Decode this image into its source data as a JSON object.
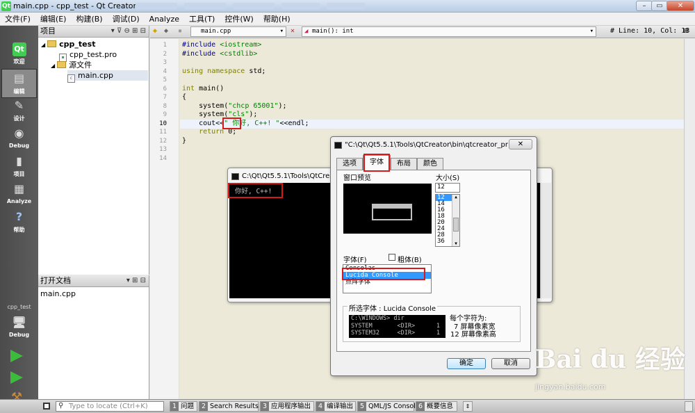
{
  "window": {
    "title": "main.cpp - cpp_test - Qt Creator",
    "qt_logo": "Qt"
  },
  "menu": [
    "文件(F)",
    "编辑(E)",
    "构建(B)",
    "调试(D)",
    "Analyze",
    "工具(T)",
    "控件(W)",
    "帮助(H)"
  ],
  "modes": [
    {
      "label": "欢迎",
      "icon": "qt-logo-icon"
    },
    {
      "label": "编辑",
      "icon": "edit-document-icon"
    },
    {
      "label": "设计",
      "icon": "design-pencil-icon"
    },
    {
      "label": "Debug",
      "icon": "debug-icon"
    },
    {
      "label": "项目",
      "icon": "projects-icon"
    },
    {
      "label": "Analyze",
      "icon": "analyze-icon"
    },
    {
      "label": "帮助",
      "icon": "help-icon"
    }
  ],
  "kit": {
    "project": "cpp_test",
    "config": "Debug"
  },
  "project_panel": {
    "header": "项目",
    "tree": [
      {
        "label": "cpp_test",
        "level": 0
      },
      {
        "label": "cpp_test.pro",
        "level": 1
      },
      {
        "label": "源文件",
        "level": 1
      },
      {
        "label": "main.cpp",
        "level": 2
      }
    ]
  },
  "open_docs": {
    "header": "打开文档",
    "items": [
      "main.cpp"
    ]
  },
  "editor_toolbar": {
    "file": "main.cpp",
    "symbol": "main(): int",
    "position": "Line: 10, Col: 13",
    "hash": "#"
  },
  "code": {
    "line_numbers": [
      "1",
      "2",
      "3",
      "4",
      "5",
      "6",
      "7",
      "8",
      "9",
      "10",
      "11",
      "12",
      "13",
      "14"
    ],
    "current_line": "10",
    "lines": [
      [
        [
          "pp",
          "#include "
        ],
        [
          "str",
          "<iostream>"
        ]
      ],
      [
        [
          "pp",
          "#include "
        ],
        [
          "str",
          "<cstdlib>"
        ]
      ],
      [],
      [
        [
          "kw",
          "using namespace "
        ],
        [
          "",
          "std;"
        ]
      ],
      [],
      [
        [
          "kw",
          "int "
        ],
        [
          "",
          "main()"
        ]
      ],
      [
        [
          "",
          "{"
        ]
      ],
      [
        [
          "",
          "    system("
        ],
        [
          "str",
          "\"chcp 65001\""
        ],
        [
          "",
          ");"
        ]
      ],
      [
        [
          "",
          "    system("
        ],
        [
          "str",
          "\"cls\""
        ],
        [
          "",
          ");"
        ]
      ],
      [
        [
          "",
          "    cout<<"
        ],
        [
          "str",
          "\" 你好, C++! \""
        ],
        [
          "",
          "<<endl;"
        ]
      ],
      [
        [
          "kw",
          "    return "
        ],
        [
          "",
          "0;"
        ]
      ],
      [
        [
          "",
          "}"
        ]
      ],
      [],
      []
    ]
  },
  "console": {
    "title": "C:\\Qt\\Qt5.5.1\\Tools\\QtCreator\\bin",
    "output": "你好, C++!"
  },
  "props_dialog": {
    "title": "\"C:\\Qt\\Qt5.5.1\\Tools\\QtCreator\\bin\\qtcreator_pro...",
    "close": "✕",
    "tabs": [
      "选项",
      "字体",
      "布局",
      "颜色"
    ],
    "selected_tab": "字体",
    "preview_label": "窗口预览",
    "size_label": "大小(S)",
    "size_value": "12",
    "sizes": [
      "12",
      "14",
      "16",
      "18",
      "20",
      "24",
      "28",
      "36"
    ],
    "font_label": "字体(F)",
    "bold_label": "粗体(B)",
    "fonts": [
      "Consolas",
      "Lucida Console",
      "点阵字体"
    ],
    "selected_font": "Lucida Console",
    "selected_font_label": "所选字体 : Lucida Console",
    "sample": "C:\\WINDOWS> dir\nSYSTEM       <DIR>      1\nSYSTEM32     <DIR>      1",
    "char_info_title": "每个字符为:",
    "char_width": "7 屏幕像素宽",
    "char_height": "12 屏幕像素高",
    "ok": "确定",
    "cancel": "取消"
  },
  "statusbar": {
    "locate_placeholder": "Type to locate (Ctrl+K)",
    "tabs": [
      {
        "n": "1",
        "label": "问题"
      },
      {
        "n": "2",
        "label": "Search Results"
      },
      {
        "n": "3",
        "label": "应用程序输出"
      },
      {
        "n": "4",
        "label": "编译输出"
      },
      {
        "n": "5",
        "label": "QML/JS Console"
      },
      {
        "n": "6",
        "label": "概要信息"
      }
    ]
  },
  "watermark": {
    "brand": "Bai du 经验",
    "url": "jingyan.baidu.com"
  }
}
